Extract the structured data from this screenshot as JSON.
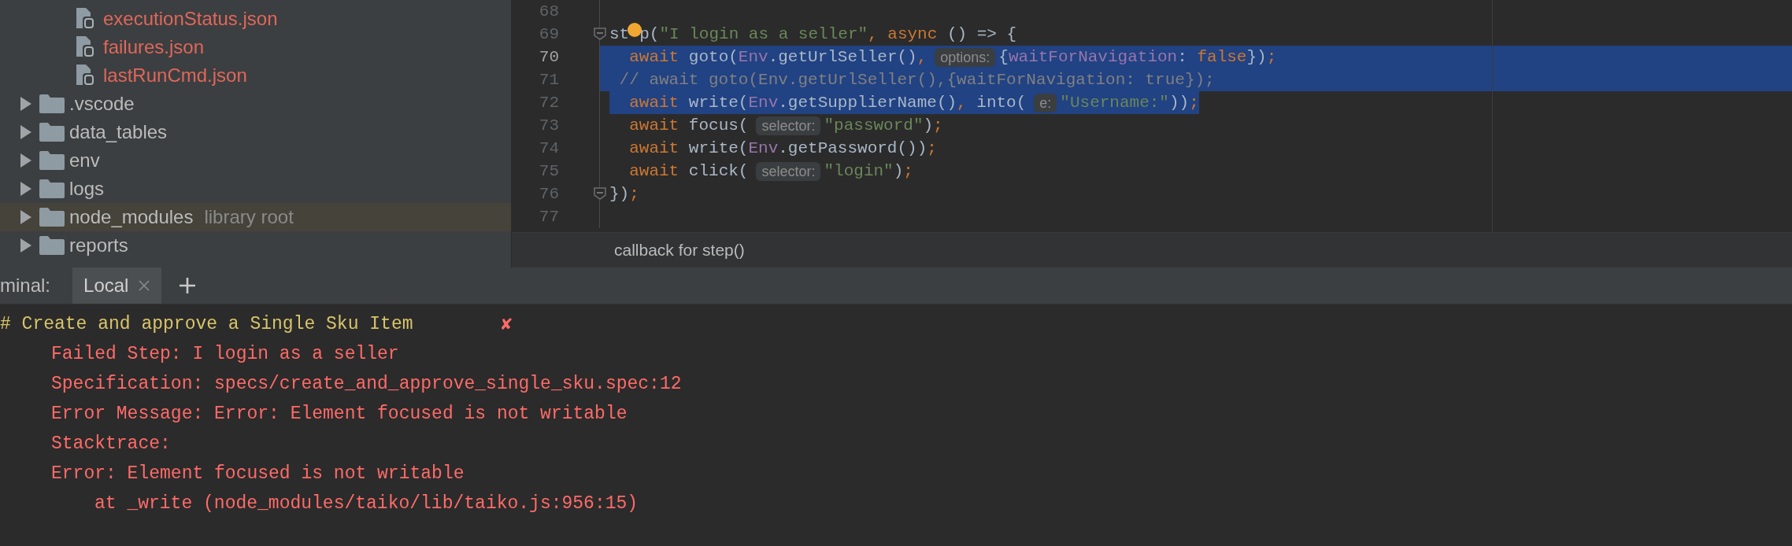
{
  "project_tree": {
    "items": [
      {
        "name": "executionStatus.json",
        "kind": "file",
        "color": "#e0675a",
        "selected": false
      },
      {
        "name": "failures.json",
        "kind": "file",
        "color": "#e0675a",
        "selected": false
      },
      {
        "name": "lastRunCmd.json",
        "kind": "file",
        "color": "#e0675a",
        "selected": false
      },
      {
        "name": ".vscode",
        "kind": "folder",
        "color": "#bbbbbb",
        "selected": false,
        "expanded": false
      },
      {
        "name": "data_tables",
        "kind": "folder",
        "color": "#bbbbbb",
        "selected": false,
        "expanded": false
      },
      {
        "name": "env",
        "kind": "folder",
        "color": "#bbbbbb",
        "selected": false,
        "expanded": false
      },
      {
        "name": "logs",
        "kind": "folder",
        "color": "#bbbbbb",
        "selected": false,
        "expanded": false
      },
      {
        "name": "node_modules",
        "kind": "folder",
        "color": "#bbbbbb",
        "selected": true,
        "expanded": false,
        "note": "library root"
      },
      {
        "name": "reports",
        "kind": "folder",
        "color": "#bbbbbb",
        "selected": false,
        "expanded": false
      }
    ]
  },
  "editor": {
    "lines": [
      {
        "number": "68",
        "current": false,
        "selected": false
      },
      {
        "number": "69",
        "current": false,
        "selected": false,
        "fold": true,
        "segments": [
          {
            "kind": "code",
            "tokens": [
              {
                "kind": "plain",
                "text": "st"
              }
            ]
          },
          {
            "kind": "bulb"
          },
          {
            "kind": "code",
            "tokens": [
              {
                "kind": "plain",
                "text": "p("
              },
              {
                "kind": "string",
                "text": "\"I login as a seller\""
              },
              {
                "kind": "keyword",
                "text": ", async"
              },
              {
                "kind": "plain",
                "text": " () => {"
              }
            ]
          }
        ]
      },
      {
        "number": "70",
        "current": true,
        "selected": true,
        "selection_to_edge": true,
        "segments": [
          {
            "kind": "code",
            "tokens": [
              {
                "kind": "keyword",
                "text": "  await"
              },
              {
                "kind": "plain",
                "text": " goto("
              },
              {
                "kind": "object",
                "text": "Env"
              },
              {
                "kind": "plain",
                "text": ".getUrlSeller()"
              },
              {
                "kind": "keyword",
                "text": ","
              }
            ]
          },
          {
            "kind": "hint",
            "text": "options:"
          },
          {
            "kind": "code",
            "tokens": [
              {
                "kind": "plain",
                "text": "{"
              },
              {
                "kind": "object",
                "text": "waitForNavigation"
              },
              {
                "kind": "plain",
                "text": ": "
              },
              {
                "kind": "keyword",
                "text": "false"
              },
              {
                "kind": "plain",
                "text": "})"
              },
              {
                "kind": "keyword",
                "text": ";"
              }
            ]
          }
        ]
      },
      {
        "number": "71",
        "current": false,
        "selected": true,
        "selection_to_edge": true,
        "segments": [
          {
            "kind": "code",
            "tokens": [
              {
                "kind": "comment",
                "text": " // await goto(Env.getUrlSeller(),{waitForNavigation: true});"
              }
            ]
          }
        ]
      },
      {
        "number": "72",
        "current": false,
        "selected": true,
        "selection_to_edge": false,
        "segments": [
          {
            "kind": "code",
            "tokens": [
              {
                "kind": "keyword",
                "text": "  await"
              },
              {
                "kind": "plain",
                "text": " write("
              },
              {
                "kind": "object",
                "text": "Env"
              },
              {
                "kind": "plain",
                "text": ".getSupplierName()"
              },
              {
                "kind": "keyword",
                "text": ","
              },
              {
                "kind": "plain",
                "text": " into("
              }
            ]
          },
          {
            "kind": "hint",
            "text": "e:"
          },
          {
            "kind": "code",
            "tokens": [
              {
                "kind": "string",
                "text": "\"Username:\""
              },
              {
                "kind": "plain",
                "text": "))"
              },
              {
                "kind": "keyword",
                "text": ";"
              }
            ]
          }
        ]
      },
      {
        "number": "73",
        "current": false,
        "selected": false,
        "segments": [
          {
            "kind": "code",
            "tokens": [
              {
                "kind": "keyword",
                "text": "  await"
              },
              {
                "kind": "plain",
                "text": " focus("
              }
            ]
          },
          {
            "kind": "hint",
            "text": "selector:"
          },
          {
            "kind": "code",
            "tokens": [
              {
                "kind": "string",
                "text": "\"password\""
              },
              {
                "kind": "plain",
                "text": ")"
              },
              {
                "kind": "keyword",
                "text": ";"
              }
            ]
          }
        ]
      },
      {
        "number": "74",
        "current": false,
        "selected": false,
        "segments": [
          {
            "kind": "code",
            "tokens": [
              {
                "kind": "keyword",
                "text": "  await"
              },
              {
                "kind": "plain",
                "text": " write("
              },
              {
                "kind": "object",
                "text": "Env"
              },
              {
                "kind": "plain",
                "text": ".getPassword())"
              },
              {
                "kind": "keyword",
                "text": ";"
              }
            ]
          }
        ]
      },
      {
        "number": "75",
        "current": false,
        "selected": false,
        "segments": [
          {
            "kind": "code",
            "tokens": [
              {
                "kind": "keyword",
                "text": "  await"
              },
              {
                "kind": "plain",
                "text": " click("
              }
            ]
          },
          {
            "kind": "hint",
            "text": "selector:"
          },
          {
            "kind": "code",
            "tokens": [
              {
                "kind": "string",
                "text": "\"login\""
              },
              {
                "kind": "plain",
                "text": ")"
              },
              {
                "kind": "keyword",
                "text": ";"
              }
            ]
          }
        ]
      },
      {
        "number": "76",
        "current": false,
        "selected": false,
        "fold": true,
        "segments": [
          {
            "kind": "code",
            "tokens": [
              {
                "kind": "plain",
                "text": "})"
              },
              {
                "kind": "keyword",
                "text": ";"
              }
            ]
          }
        ]
      },
      {
        "number": "77",
        "current": false,
        "selected": false
      }
    ],
    "context_hint": "callback for step()"
  },
  "terminal": {
    "label": "minal:",
    "tabs": [
      {
        "label": "Local",
        "selected": true
      }
    ],
    "lines": [
      {
        "kind": "heading",
        "text": "# Create and approve a Single Sku Item",
        "mark": "✘"
      },
      {
        "kind": "error",
        "text": "Failed Step: I login as a seller"
      },
      {
        "kind": "error",
        "text": "Specification: specs/create_and_approve_single_sku.spec:12"
      },
      {
        "kind": "error",
        "text": "Error Message: Error: Element focused is not writable"
      },
      {
        "kind": "error",
        "text": "Stacktrace:"
      },
      {
        "kind": "error",
        "text": "Error: Element focused is not writable"
      },
      {
        "kind": "trace",
        "text": "at _write (node_modules/taiko/lib/taiko.js:956:15)"
      }
    ]
  }
}
